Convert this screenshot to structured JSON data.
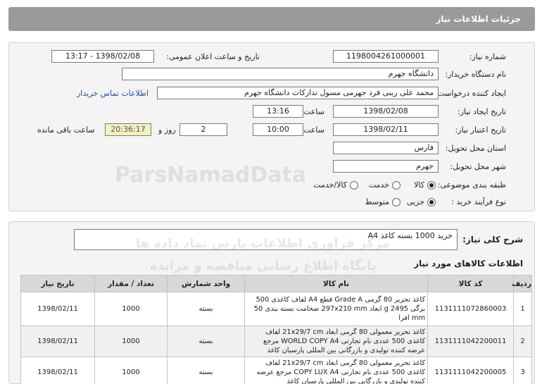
{
  "header": {
    "title": "جزئیات اطلاعات نیاز"
  },
  "fields": {
    "need_number_label": "شماره نیاز:",
    "need_number": "1198004261000001",
    "announce_label": "تاریخ و ساعت اعلان عمومی:",
    "announce_value": "1398/02/08 - 13:17",
    "buyer_org_label": "نام دستگاه خریدار:",
    "buyer_org": "دانشگاه جهرم",
    "requester_label": "ایجاد کننده درخواست:",
    "requester": "محمد علی رینی فرد جهرمی مسول تدارکات دانشگاه جهرم",
    "contact_link": "اطلاعات تماس خریدار",
    "created_label": "تاریخ ایجاد نیاز:",
    "created_date": "1398/02/08",
    "time_label": "ساعت",
    "created_time": "13:16",
    "validity_label": "تاریخ اعتبار نیاز:",
    "validity_date": "1398/02/11",
    "validity_time": "10:00",
    "days_value": "2",
    "days_label": "روز و",
    "remaining_value": "20:36:17",
    "remaining_label": "ساعت باقی مانده",
    "province_label": "استان محل تحویل:",
    "province": "فارس",
    "city_label": "شهر محل تحویل:",
    "city": "جهرم",
    "category_label": "طبقه بندی موضوعی:",
    "category_options": [
      "کالا",
      "خدمت",
      "کالا/خدمت"
    ],
    "purchase_type_label": "نوع فرآیند خرید :",
    "purchase_type_options": [
      "جزیی",
      "متوسط"
    ]
  },
  "summary": {
    "title": "شرح کلی نیاز:",
    "text": "خرید 1000 بسته کاغذ A4"
  },
  "goods": {
    "title": "اطلاعات کالاهای مورد نیاز",
    "columns": [
      "ردیف",
      "کد کالا",
      "نام کالا",
      "واحد شمارش",
      "تعداد / مقدار",
      "تاریخ نیاز"
    ],
    "rows": [
      {
        "row": "1",
        "code": "1131111072860003",
        "name": "کاغذ تحریر 80 گرمی Grade A قطع A4 لفاف کاغذی 500 برگی 2495 g ابعاد 297x210 mm ضخامت بسته بندی 50 mm افرا",
        "unit": "بسته",
        "qty": "1000",
        "date": "1398/02/11"
      },
      {
        "row": "2",
        "code": "1131111042200011",
        "name": "کاغذ تحریر معمولی 80 گرمی ابعاد 21x29/7 cm لفاف کاغذی 500 عددی نام تجارتی WORLD COPY A4 مرجع عرضه کننده تولیدی و بازرگانی بین المللی پارسیان کاغذ",
        "unit": "بسته",
        "qty": "1000",
        "date": "1398/02/11"
      },
      {
        "row": "3",
        "code": "1131111042200005",
        "name": "کاغذ تحریر معمولی 80 گرمی ابعاد 21x29/7 cm لفاف کاغذی 500 عددی نام تجارتی COPY LUX A4 مرجع عرضه کننده تولیدی و بازرگانی بین المللی پارسیان کاغذ",
        "unit": "بسته",
        "qty": "1000",
        "date": "1398/02/11"
      }
    ]
  },
  "watermark": {
    "brand": "ParsNamadData",
    "phone_fragment": "۰۲۱-۸۸۳۴۹۶۷۰",
    "line1": "مرکز فراوری اطلاعات پارس نماد داده ها",
    "line2": "پایگاه اطلاع رسانی مناقصه و مزایده"
  },
  "colors": {
    "header_bg": "#9a9a9a",
    "panel_bg": "#f4f4f4",
    "link": "#1a4fb5",
    "remaining_bg": "#f3f0c4",
    "table_header_bg": "#d8d8d8"
  }
}
